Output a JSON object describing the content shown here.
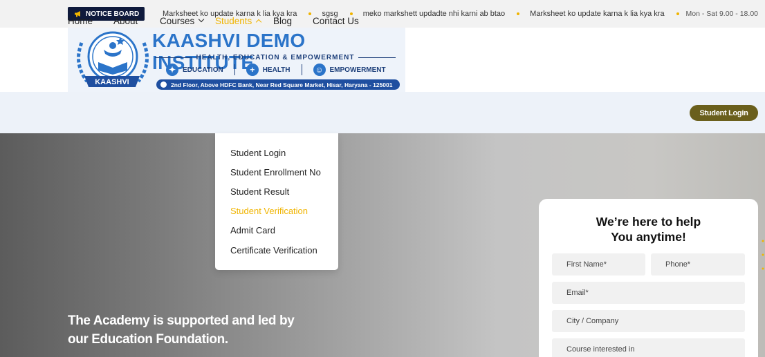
{
  "topbar": {
    "notice_label": "NOTICE BOARD",
    "ticker": [
      "Marksheet ko update karna k lia kya kra",
      "sgsg",
      "meko markshett updadte nhi karni ab btao",
      "Marksheet ko update karna k lia kya kra"
    ],
    "hours": "Mon - Sat 9.00 - 18.00"
  },
  "logo": {
    "title": "KAASHVI DEMO INSTITUTE",
    "tagline": "HEALTH, EDUCATION & EMPOWERMENT",
    "pillars": [
      "EDUCATION",
      "HEALTH",
      "EMPOWERMENT"
    ],
    "ribbon": "KAASHVI",
    "address": "2nd Floor, Above HDFC Bank, Near Red Square Market, Hisar, Haryana - 125001"
  },
  "nav": {
    "items": [
      "Home",
      "About",
      "Courses",
      "Students",
      "Blog",
      "Contact Us"
    ],
    "login_label": "Student Login"
  },
  "dropdown": {
    "items": [
      "Student Login",
      "Student Enrollment No",
      "Student Result",
      "Student Verification",
      "Admit Card",
      "Certificate Verification"
    ]
  },
  "hero": {
    "line1": "The Academy is supported and led by",
    "line2": "our Education Foundation."
  },
  "form": {
    "title_line1": "We’re here to help",
    "title_line2": "You anytime!",
    "first_name": "First Name*",
    "phone": "Phone*",
    "email": "Email*",
    "city": "City / Company",
    "course": "Course interested in"
  },
  "colors": {
    "accent": "#f0b400",
    "navy": "#0f1a3c",
    "login_button": "#6a5f1c",
    "logo_blue": "#2b74c9"
  }
}
